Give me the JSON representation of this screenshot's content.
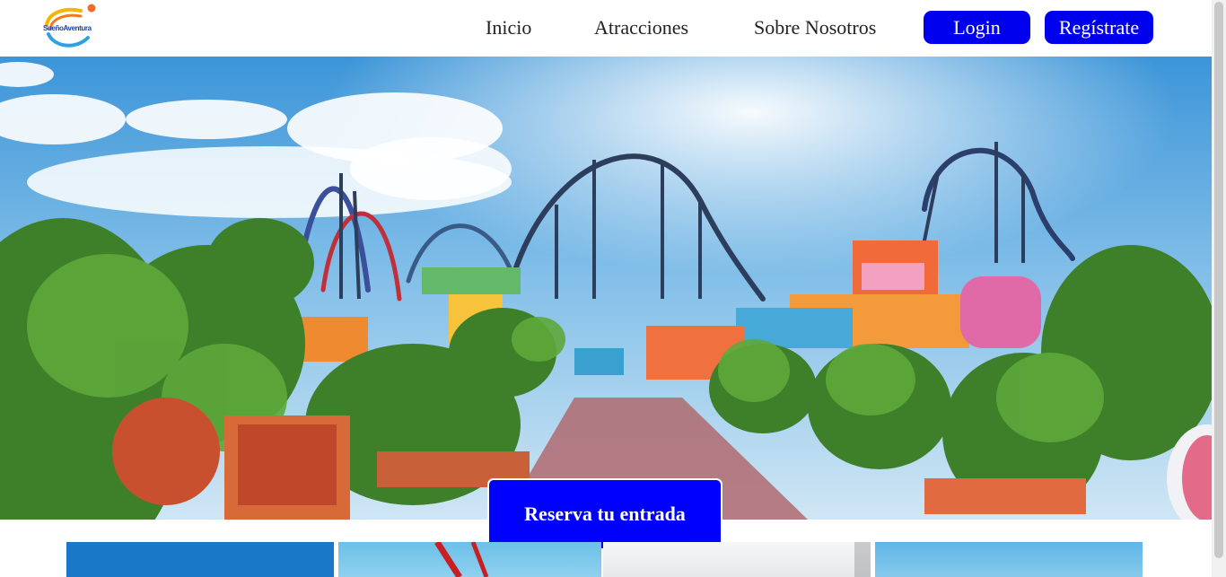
{
  "header": {
    "logo_text": "SueñoAventura",
    "nav": {
      "inicio": "Inicio",
      "atracciones": "Atracciones",
      "sobre": "Sobre Nosotros"
    },
    "login_label": "Login",
    "register_label": "Regístrate"
  },
  "hero": {
    "cta_label": "Reserva tu entrada"
  },
  "colors": {
    "primary_button": "#0000ee",
    "hero_cta": "#0000ff"
  },
  "cards": [
    {
      "name": "attraction-card-1"
    },
    {
      "name": "attraction-card-2"
    },
    {
      "name": "attraction-card-3"
    },
    {
      "name": "attraction-card-4"
    }
  ]
}
